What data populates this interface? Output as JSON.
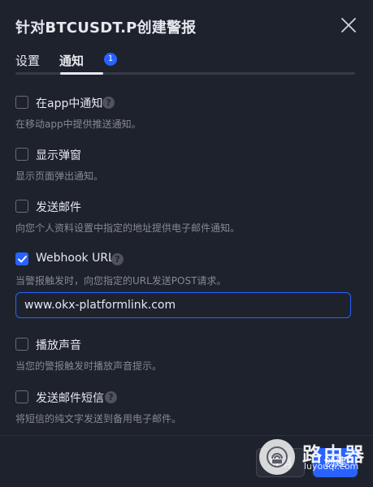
{
  "dialog": {
    "title": "针对BTCUSDT.P创建警报",
    "close_icon": "close-icon"
  },
  "tabs": [
    {
      "label": "设置",
      "active": false
    },
    {
      "label": "通知",
      "active": true,
      "badge": "1"
    }
  ],
  "options": [
    {
      "label": "在app中通知",
      "checked": false,
      "help": true,
      "description": "在移动app中提供推送通知。"
    },
    {
      "label": "显示弹窗",
      "checked": false,
      "help": false,
      "description": "显示页面弹出通知。"
    },
    {
      "label": "发送邮件",
      "checked": false,
      "help": false,
      "description": "向您个人资料设置中指定的地址提供电子邮件通知。"
    },
    {
      "label": "Webhook URL",
      "checked": true,
      "help": true,
      "description": "当警报触发时，向您指定的URL发送POST请求。"
    },
    {
      "label": "播放声音",
      "checked": false,
      "help": false,
      "description": "当您的警报触发时播放声音提示。"
    },
    {
      "label": "发送邮件短信",
      "checked": false,
      "help": true,
      "description": "将短信的纯文字发送到备用电子邮件。"
    }
  ],
  "webhook": {
    "value": "www.okx-platformlink.com"
  },
  "footer": {
    "cancel_label": "取消",
    "create_label": "创建"
  },
  "watermark": {
    "text": "路由器",
    "subtext": "luyouqi.com"
  },
  "colors": {
    "background": "#1e222d",
    "accent": "#2962ff",
    "text": "#e6e8ee",
    "muted": "#868993"
  }
}
